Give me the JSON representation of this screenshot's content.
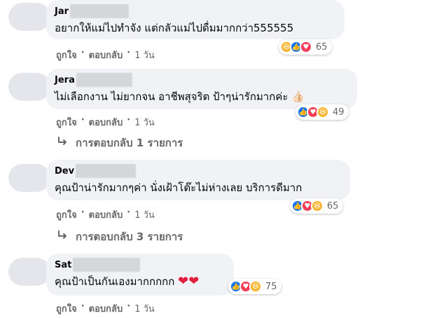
{
  "comments": [
    {
      "author_visible": "Jar",
      "text": "อยากให้แม่ไปทำจัง แต่กลัวแม่ไปดื่มมากกว่า555555",
      "reactions": [
        "haha",
        "like",
        "love"
      ],
      "reaction_count": "65",
      "like_label": "ถูกใจ",
      "reply_label": "ตอบกลับ",
      "time": "1 วัน"
    },
    {
      "author_visible": "Jera",
      "text": "ไม่เลือกงาน ไม่ยากจน อาชีพสุจริต ป้าๆน่ารักมากค่ะ 👍🏻",
      "reactions": [
        "like",
        "love",
        "haha"
      ],
      "reaction_count": "49",
      "like_label": "ถูกใจ",
      "reply_label": "ตอบกลับ",
      "time": "1 วัน",
      "replies_label": "การตอบกลับ 1 รายการ"
    },
    {
      "author_visible": "Dev",
      "text": "คุณป้าน่ารักมากๆค่า นั่งเฝ้าโต๊ะไม่ห่างเลย บริการดีมาก",
      "reactions": [
        "like",
        "love",
        "haha"
      ],
      "reaction_count": "65",
      "like_label": "ถูกใจ",
      "reply_label": "ตอบกลับ",
      "time": "1 วัน",
      "replies_label": "การตอบกลับ 3 รายการ"
    },
    {
      "author_visible": "Sat",
      "text": "คุณป้าเป็นกันเองมากกกกก",
      "hearts": "❤❤",
      "reactions": [
        "like",
        "love",
        "haha"
      ],
      "reaction_count": "75",
      "like_label": "ถูกใจ",
      "reply_label": "ตอบกลับ",
      "time": "1 วัน"
    }
  ],
  "separator": "·",
  "reply_arrow_icon": "reply-arrow-icon",
  "colors": {
    "bubble": "#f0f2f5",
    "meta_text": "#65676b",
    "like": "#1877f2",
    "love": "#f33e58",
    "haha": "#f7b125"
  }
}
